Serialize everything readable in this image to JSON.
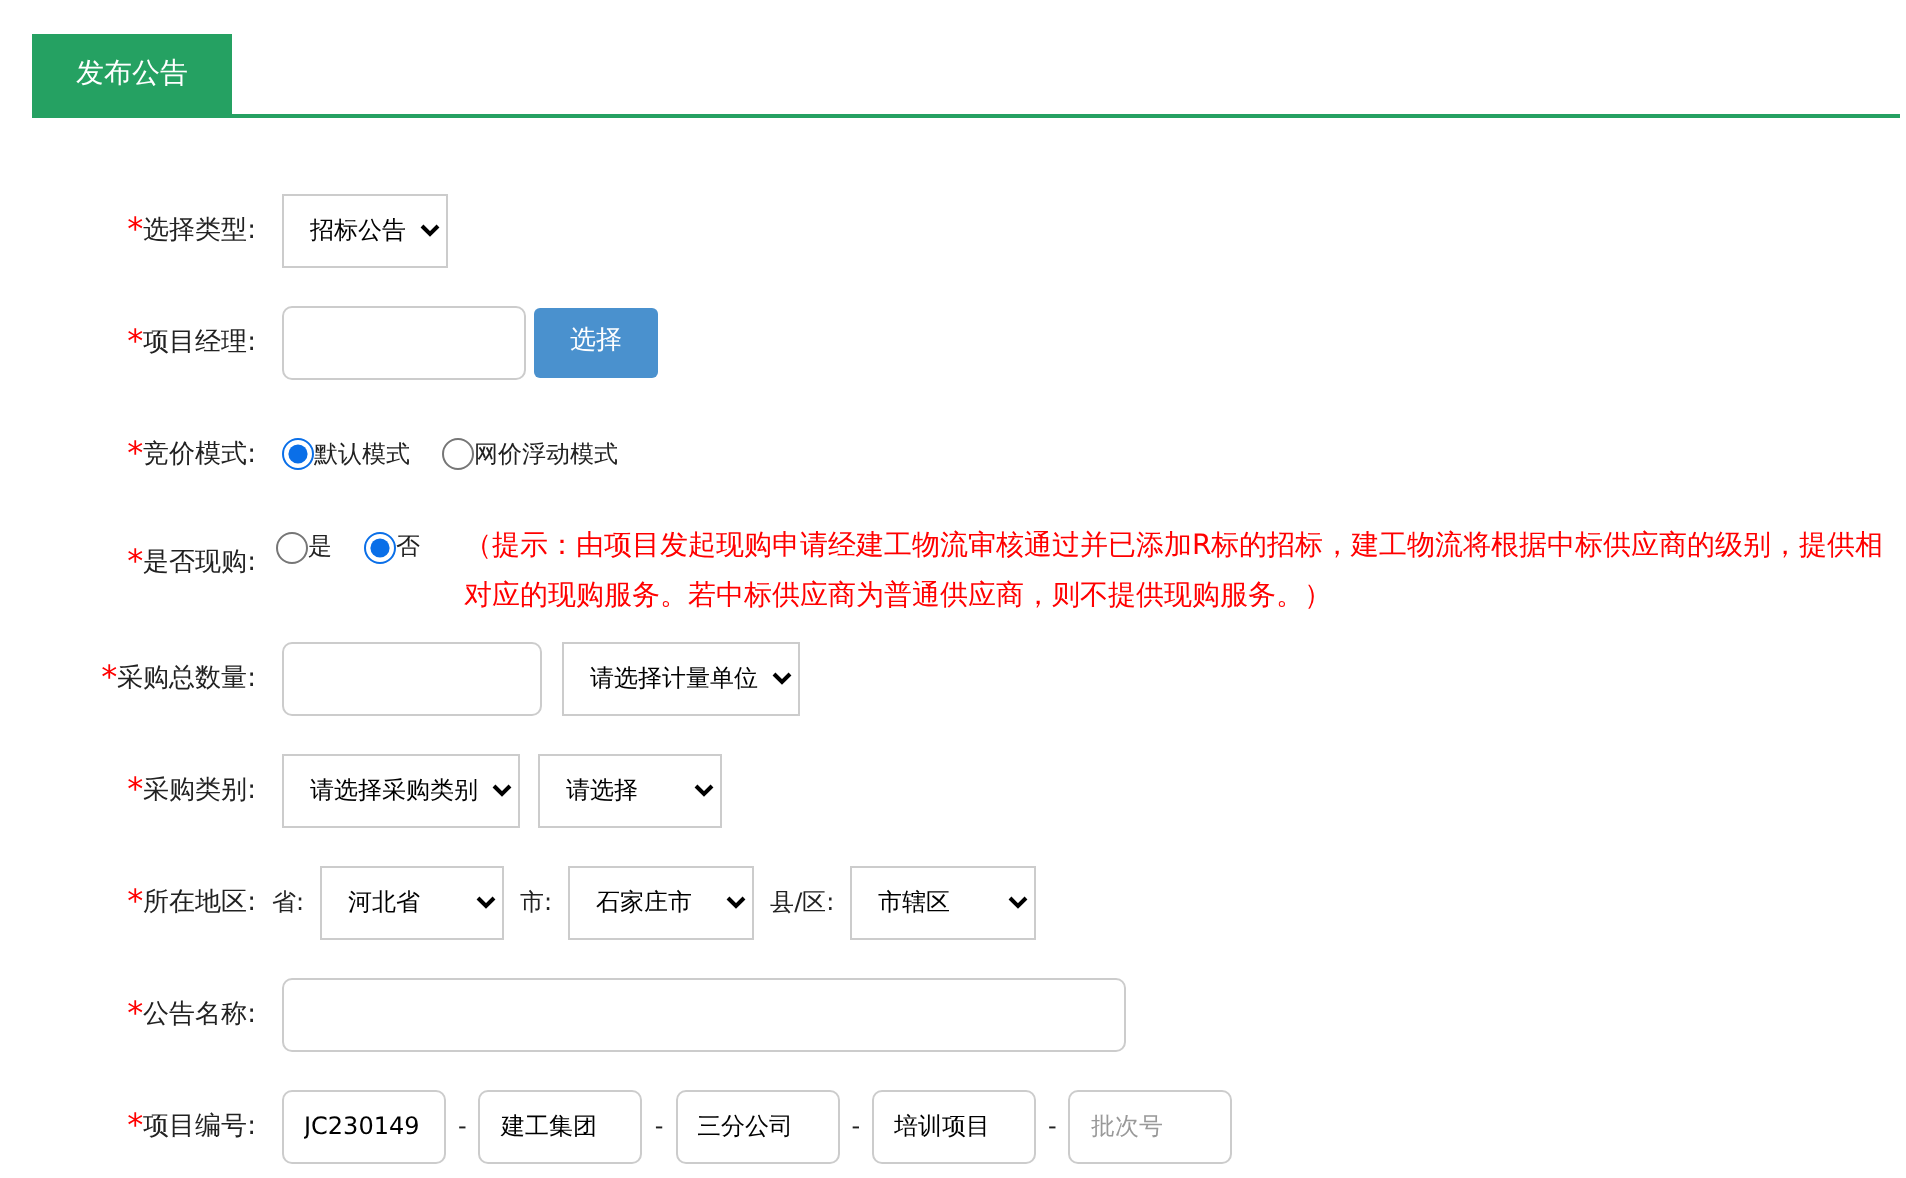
{
  "tabs": [
    {
      "label": "发布公告",
      "selected": true
    }
  ],
  "rows": [
    {
      "required": "*",
      "label": "选择类型:",
      "controls": [
        {
          "kind": "select",
          "value": "招标公告"
        }
      ]
    },
    {
      "required": "*",
      "label": "项目经理:",
      "controls": [
        {
          "kind": "input"
        },
        {
          "kind": "button",
          "label": "选择"
        }
      ]
    },
    {
      "required": "*",
      "label": "竞价模式:",
      "controls": [
        {
          "kind": "radio",
          "label": "默认模式",
          "selected": true
        },
        {
          "kind": "radio",
          "label": "网价浮动模式",
          "selected": false
        }
      ]
    },
    {
      "required": "*",
      "label": "是否现购:",
      "controls": [
        {
          "kind": "radio",
          "label": "是",
          "selected": false
        },
        {
          "kind": "radio",
          "label": "否",
          "selected": true
        },
        {
          "kind": "note",
          "text": "（提示：由项目发起现购申请经建工物流审核通过并已添加R标的招标，建工物流将根据中标供应商的级别，提供相对应的现购服务。若中标供应商为普通供应商，则不提供现购服务。）"
        }
      ]
    },
    {
      "required": "*",
      "label": "采购总数量:",
      "controls": [
        {
          "kind": "input"
        },
        {
          "kind": "select",
          "value": "请选择计量单位"
        }
      ]
    },
    {
      "required": "*",
      "label": "采购类别:",
      "controls": [
        {
          "kind": "select",
          "value": "请选择采购类别"
        },
        {
          "kind": "select",
          "value": "请选择"
        }
      ]
    },
    {
      "required": "*",
      "label": "所在地区:",
      "controls": [
        {
          "kind": "text",
          "text": "省:"
        },
        {
          "kind": "select",
          "value": "河北省"
        },
        {
          "kind": "text",
          "text": "市:"
        },
        {
          "kind": "select",
          "value": "石家庄市"
        },
        {
          "kind": "text",
          "text": "县/区:"
        },
        {
          "kind": "select",
          "value": "市辖区"
        }
      ]
    },
    {
      "required": "*",
      "label": "公告名称:",
      "controls": [
        {
          "kind": "input"
        }
      ]
    },
    {
      "required": "*",
      "label": "项目编号:",
      "controls": [
        {
          "kind": "input",
          "value": "JC230149"
        },
        {
          "kind": "text",
          "text": "-"
        },
        {
          "kind": "input",
          "value": "建工集团"
        },
        {
          "kind": "text",
          "text": "-"
        },
        {
          "kind": "input",
          "value": "三分公司"
        },
        {
          "kind": "text",
          "text": "-"
        },
        {
          "kind": "input",
          "value": "培训项目"
        },
        {
          "kind": "text",
          "text": "-"
        },
        {
          "kind": "input",
          "placeholder": "批次号"
        }
      ]
    }
  ]
}
